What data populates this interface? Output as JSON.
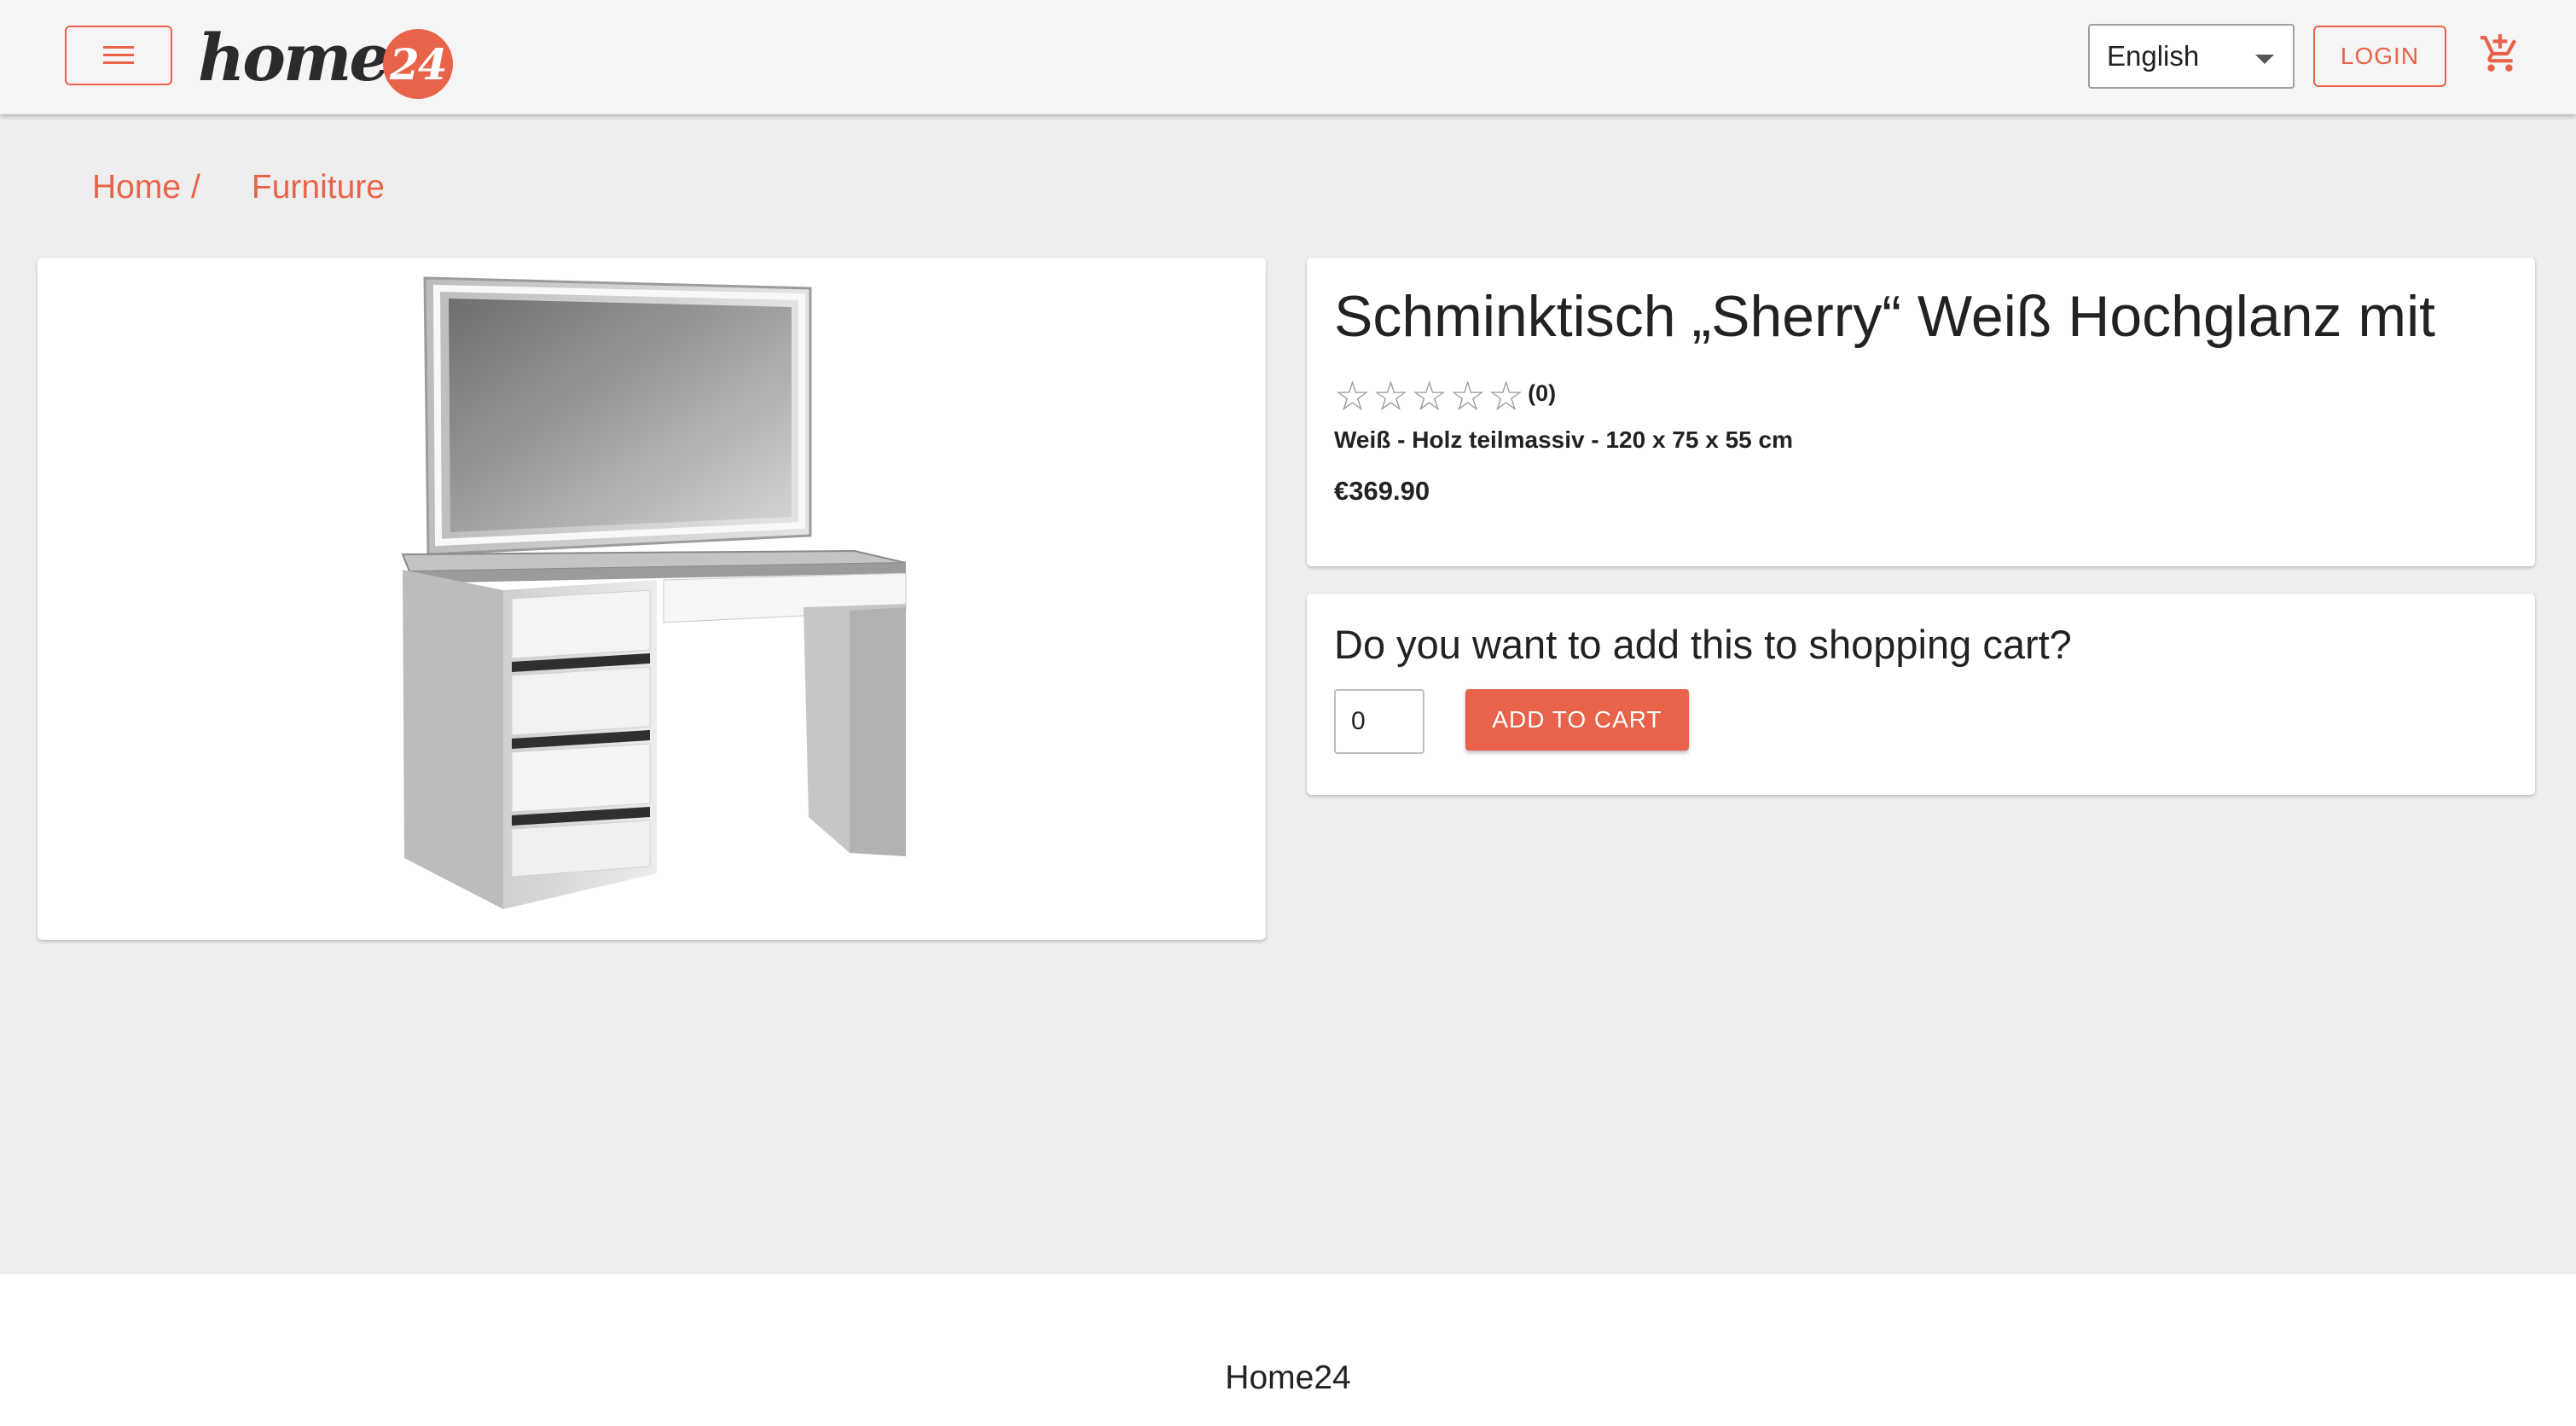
{
  "header": {
    "logo_text": "home",
    "logo_badge": "24",
    "language": "English",
    "login_label": "LOGIN"
  },
  "breadcrumb": {
    "home": "Home",
    "separator": "/",
    "category": "Furniture"
  },
  "product": {
    "title": "Schminktisch „Sherry“ Weiß Hochglanz mit",
    "rating": 0,
    "rating_max": 5,
    "rating_count": "(0)",
    "subtitle": "Weiß - Holz teilmassiv - 120 x 75 x 55 cm",
    "price": "€369.90"
  },
  "cart": {
    "question": "Do you want to add this to shopping cart?",
    "quantity": "0",
    "add_label": "ADD TO CART"
  },
  "footer": {
    "text": "Home24"
  },
  "colors": {
    "accent": "#e8634a",
    "background": "#eeeeee",
    "header_bg": "#f5f5f5",
    "card_bg": "#ffffff"
  },
  "icons": {
    "menu": "menu-icon",
    "cart": "add-shopping-cart-icon",
    "star": "star-outline-icon",
    "dropdown": "caret-down-icon"
  }
}
